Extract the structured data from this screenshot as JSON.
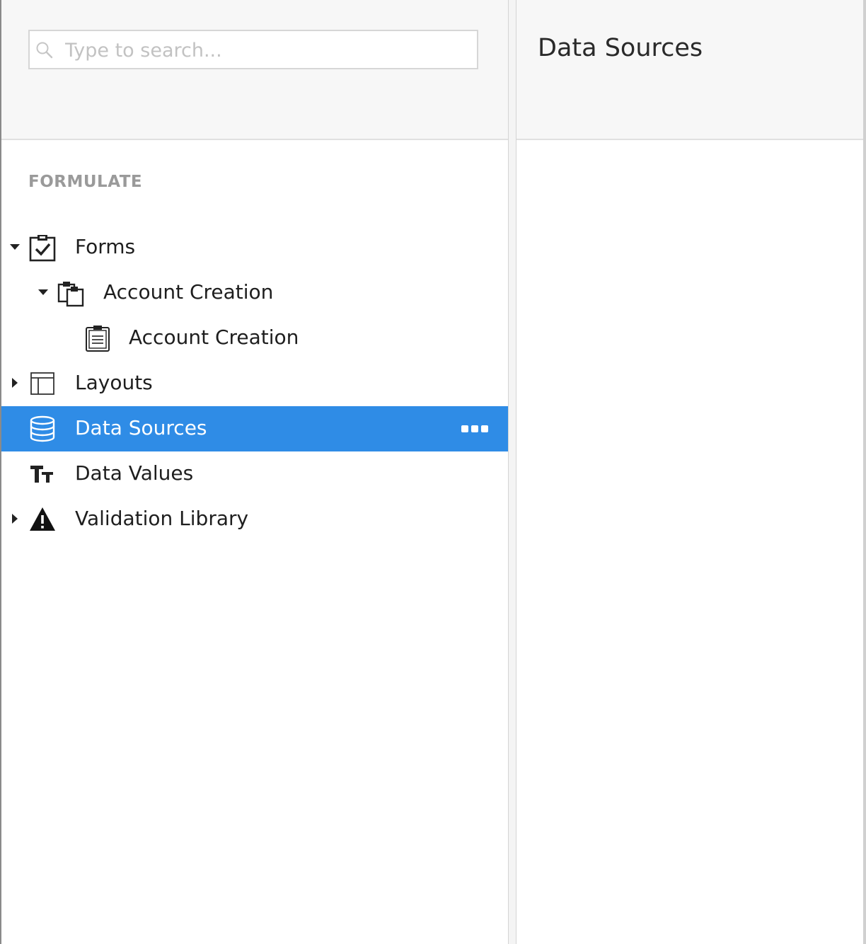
{
  "search": {
    "placeholder": "Type to search..."
  },
  "sidebar": {
    "section_title": "FORMULATE",
    "items": [
      {
        "label": "Forms",
        "icon": "clipboard-check-icon",
        "caret": "down"
      },
      {
        "label": "Account Creation",
        "icon": "clipboard-stack-icon",
        "caret": "down"
      },
      {
        "label": "Account Creation",
        "icon": "clipboard-document-icon",
        "caret": "none"
      },
      {
        "label": "Layouts",
        "icon": "layout-icon",
        "caret": "right"
      },
      {
        "label": "Data Sources",
        "icon": "database-icon",
        "caret": "none",
        "selected": true,
        "more_icon": "more-dots-icon"
      },
      {
        "label": "Data Values",
        "icon": "text-size-icon",
        "caret": "none"
      },
      {
        "label": "Validation Library",
        "icon": "warning-icon",
        "caret": "right"
      }
    ]
  },
  "main": {
    "title": "Data Sources"
  },
  "colors": {
    "selected_bg": "#2f8ce6",
    "header_bg": "#f7f7f7",
    "section_title": "#9a9a9a"
  }
}
